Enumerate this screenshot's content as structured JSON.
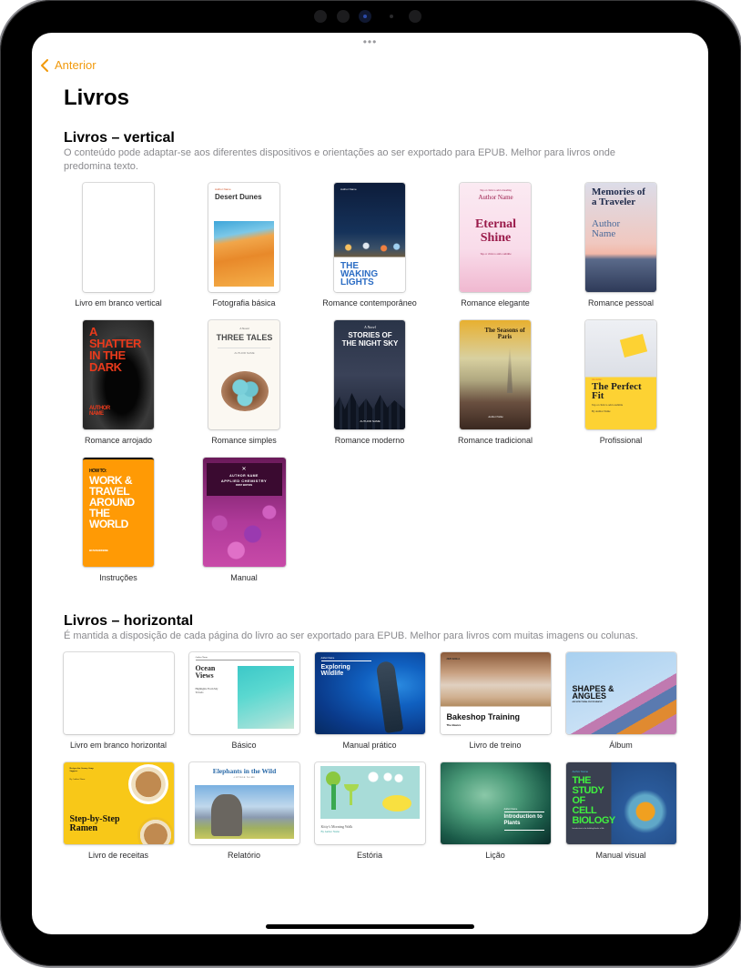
{
  "nav": {
    "back_label": "Anterior",
    "multitask_dots": "•••"
  },
  "page": {
    "title": "Livros"
  },
  "sections": [
    {
      "title": "Livros – vertical",
      "description": "O conteúdo pode adaptar-se aos diferentes dispositivos e orientações ao ser exportado para EPUB. Melhor para livros onde predomina texto.",
      "templates": [
        {
          "label": "Livro em branco vertical"
        },
        {
          "label": "Fotografia básica",
          "cover": {
            "author": "Author Name",
            "title": "Desert Dunes"
          }
        },
        {
          "label": "Romance contemporâneo",
          "cover": {
            "author": "Author Name",
            "title": "THE WAKING LIGHTS"
          }
        },
        {
          "label": "Romance elegante",
          "cover": {
            "heading": "Tap or click to add a heading",
            "author": "Author Name",
            "title": "Eternal Shine",
            "subtitle": "Tap or click to add a subtitle"
          }
        },
        {
          "label": "Romance pessoal",
          "cover": {
            "title": "Memories of a Traveler",
            "author": "Author Name"
          }
        },
        {
          "label": "Romance arrojado",
          "cover": {
            "title": "A SHATTER IN THE DARK",
            "author": "AUTHOR NAME"
          }
        },
        {
          "label": "Romance simples",
          "cover": {
            "kicker": "A Novel",
            "title": "THREE TALES",
            "author": "AUTHOR NAME"
          }
        },
        {
          "label": "Romance moderno",
          "cover": {
            "kicker": "A Novel",
            "title": "STORIES OF THE NIGHT SKY",
            "author": "AUTHOR NAME"
          }
        },
        {
          "label": "Romance tradicional",
          "cover": {
            "title": "The Seasons of Paris",
            "author": "Author Name"
          }
        },
        {
          "label": "Profissional",
          "cover": {
            "kicker": "HEADING",
            "title": "The Perfect Fit",
            "subtitle": "Tap or click to add a subtitle",
            "author": "By Author Name"
          }
        },
        {
          "label": "Instruções",
          "cover": {
            "kicker": "HOW TO:",
            "title": "WORK & TRAVEL AROUND THE WORLD",
            "author": "BY AUTHOR NAME"
          }
        },
        {
          "label": "Manual",
          "cover": {
            "author": "AUTHOR NAME",
            "title": "APPLIED CHEMISTRY",
            "subtitle": "FIRST EDITION"
          }
        }
      ]
    },
    {
      "title": "Livros – horizontal",
      "description": "É mantida a disposição de cada página do livro ao ser exportado para EPUB. Melhor para livros com muitas imagens ou colunas.",
      "templates": [
        {
          "label": "Livro em branco horizontal"
        },
        {
          "label": "Básico",
          "cover": {
            "author": "Author Name",
            "title": "Ocean Views",
            "subtitle": "Highlights From My Travels"
          }
        },
        {
          "label": "Manual prático",
          "cover": {
            "author": "Author Name",
            "title": "Exploring Wildlife"
          }
        },
        {
          "label": "Livro de treino",
          "cover": {
            "kicker": "2020 Edition",
            "title": "Bakeshop Training",
            "subtitle": "The Basics"
          }
        },
        {
          "label": "Álbum",
          "cover": {
            "title": "SHAPES & ANGLES",
            "subtitle": "ARCHITECTURAL PHOTOGRAPHY"
          }
        },
        {
          "label": "Livro de receitas",
          "cover": {
            "kicker": "Recipes for Savory Soup Suppers",
            "author": "By Author Name",
            "title": "Step-by-Step Ramen"
          }
        },
        {
          "label": "Relatório",
          "cover": {
            "title": "Elephants in the Wild",
            "author": "AUTHOR NAME"
          }
        },
        {
          "label": "Estória",
          "cover": {
            "title": "Kitty's Morning Walk",
            "author": "By Author Name"
          }
        },
        {
          "label": "Lição",
          "cover": {
            "author": "Author Name",
            "title": "Introduction to Plants"
          }
        },
        {
          "label": "Manual visual",
          "cover": {
            "author": "Author Name",
            "title": "THE STUDY OF CELL BIOLOGY",
            "subtitle": "Introduction to the building blocks of life"
          }
        }
      ]
    }
  ],
  "colors": {
    "accent": "#f19a0c",
    "desc_text": "#8a8a8e",
    "label_text": "#2c2c2e"
  }
}
